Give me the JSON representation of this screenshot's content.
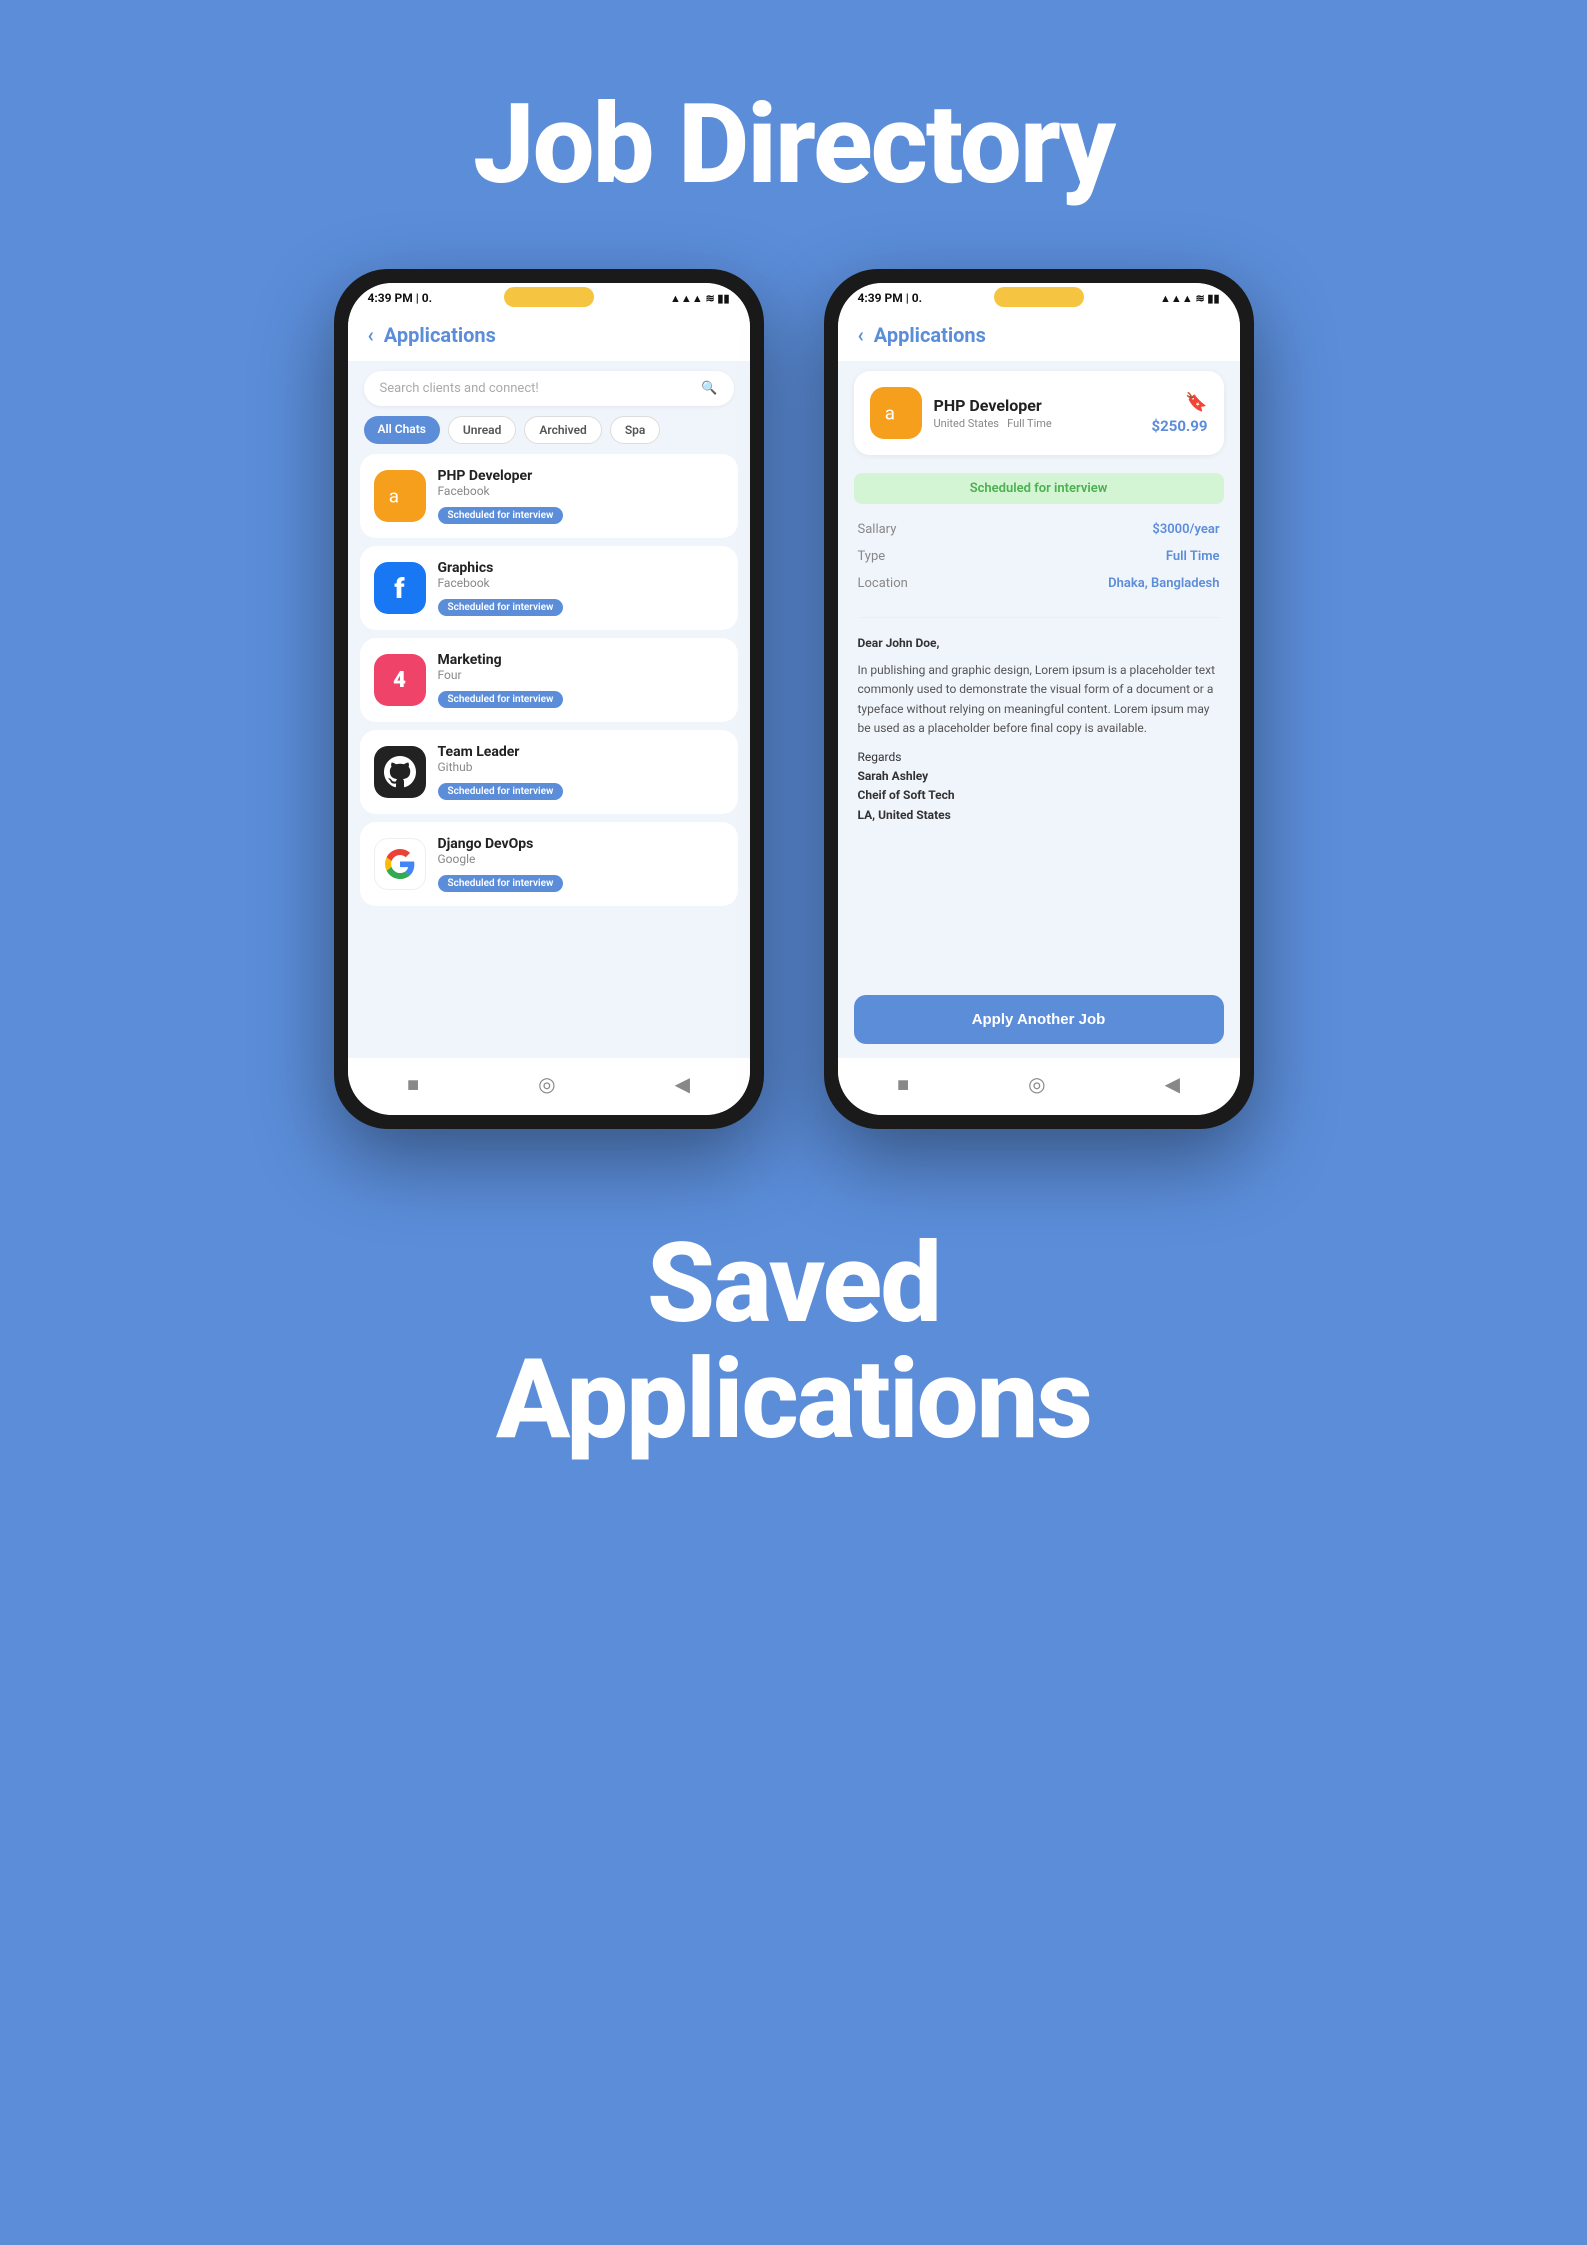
{
  "page": {
    "title": "Job Directory",
    "subtitle_line1": "Saved",
    "subtitle_line2": "Applications",
    "bg_color": "#5b8dd9"
  },
  "phone_left": {
    "status_bar": {
      "time": "4:39 PM | 0.",
      "signal": "▲▲▲",
      "wifi": "WiFi",
      "battery": "Battery"
    },
    "header": {
      "back_label": "‹",
      "title": "Applications"
    },
    "search": {
      "placeholder": "Search clients and connect!"
    },
    "tabs": [
      {
        "label": "All Chats",
        "active": true
      },
      {
        "label": "Unread",
        "active": false
      },
      {
        "label": "Archived",
        "active": false
      },
      {
        "label": "Spa",
        "active": false
      }
    ],
    "items": [
      {
        "job_title": "PHP Developer",
        "company": "Facebook",
        "status": "Scheduled for interview",
        "logo_type": "amazon"
      },
      {
        "job_title": "Graphics",
        "company": "Facebook",
        "status": "Scheduled for interview",
        "logo_type": "facebook"
      },
      {
        "job_title": "Marketing",
        "company": "Four",
        "status": "Scheduled for interview",
        "logo_type": "foursquare"
      },
      {
        "job_title": "Team Leader",
        "company": "Github",
        "status": "Scheduled for interview",
        "logo_type": "github"
      },
      {
        "job_title": "Django DevOps",
        "company": "Google",
        "status": "Scheduled for interview",
        "logo_type": "google"
      }
    ],
    "bottom_nav": [
      "■",
      "◎",
      "◀"
    ]
  },
  "phone_right": {
    "status_bar": {
      "time": "4:39 PM | 0.",
      "signal": "▲▲▲",
      "wifi": "WiFi",
      "battery": "Battery"
    },
    "header": {
      "back_label": "‹",
      "title": "Applications"
    },
    "job_card": {
      "logo_type": "amazon",
      "title": "PHP Developer",
      "location": "United States",
      "type": "Full Time",
      "price": "$250.99"
    },
    "scheduled_badge": "Scheduled for interview",
    "details": [
      {
        "label": "Sallary",
        "value": "$3000/year",
        "color": "blue"
      },
      {
        "label": "Type",
        "value": "Full Time",
        "color": "blue"
      },
      {
        "label": "Location",
        "value": "Dhaka, Bangladesh",
        "color": "blue"
      }
    ],
    "cover_letter": {
      "greeting": "Dear John Doe,",
      "body": "In publishing and graphic design, Lorem ipsum is a placeholder text commonly used to demonstrate the visual form of a document or a typeface without relying on meaningful content. Lorem ipsum may be used as a placeholder before final copy is available.",
      "regards": "Regards",
      "name": "Sarah Ashley",
      "title": "Cheif of Soft Tech",
      "location": "LA, United States"
    },
    "apply_button": "Apply Another Job",
    "bottom_nav": [
      "■",
      "◎",
      "◀"
    ]
  }
}
